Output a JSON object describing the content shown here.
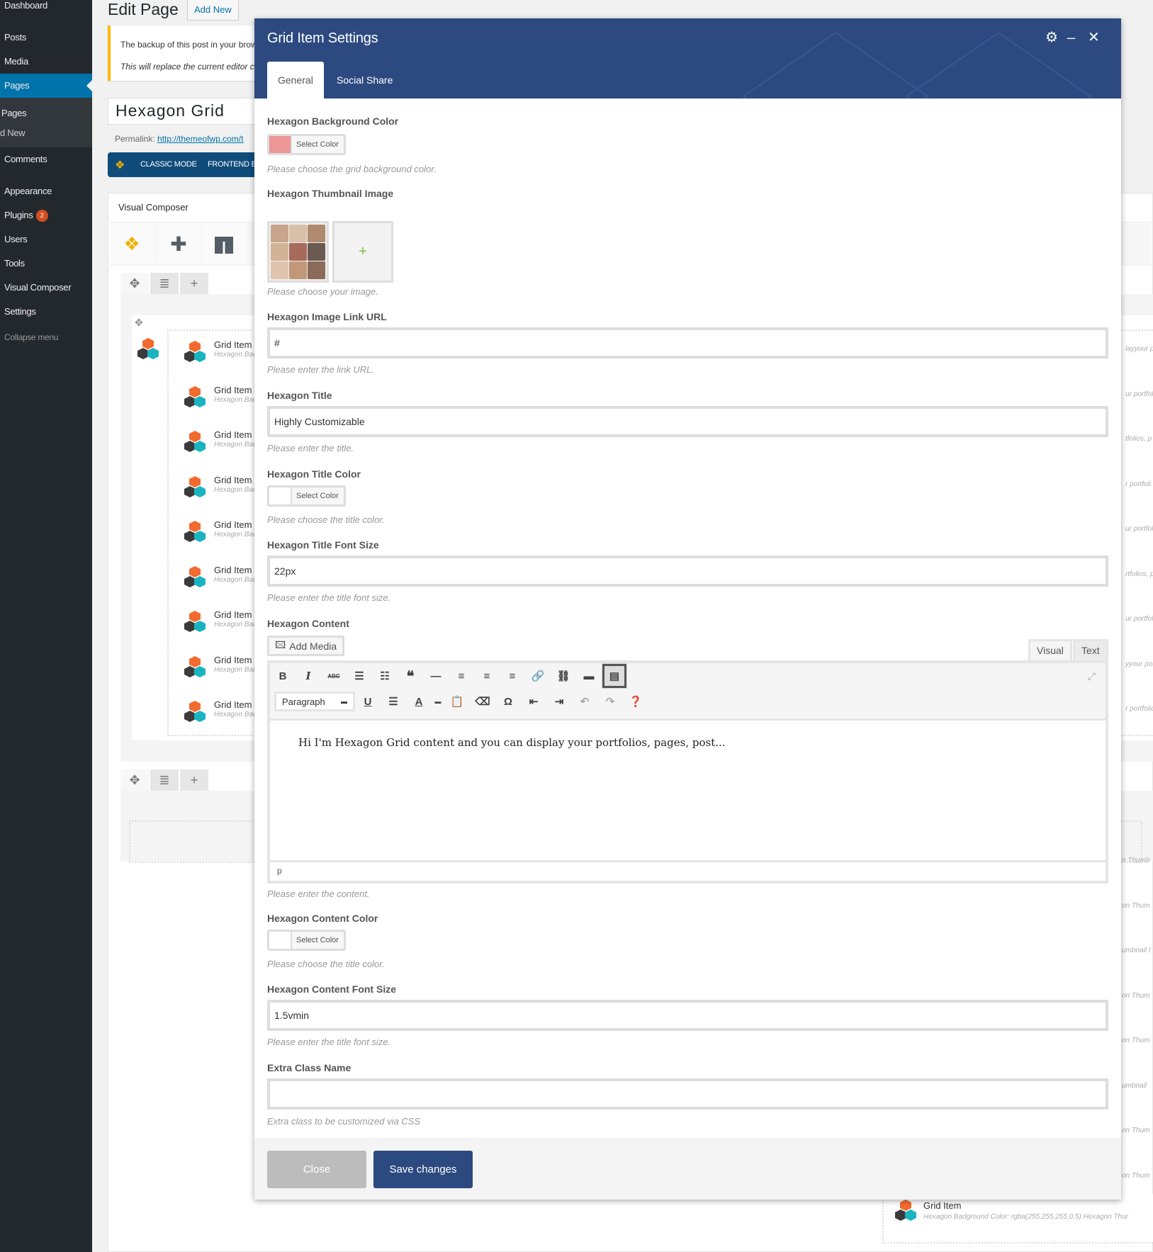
{
  "sidebar": {
    "items": [
      {
        "label": "Dashboard"
      },
      {
        "label": "Posts"
      },
      {
        "label": "Media"
      },
      {
        "label": "Pages"
      },
      {
        "label": "Comments"
      },
      {
        "label": "Appearance"
      },
      {
        "label": "Plugins",
        "badge": "2"
      },
      {
        "label": "Users"
      },
      {
        "label": "Tools"
      },
      {
        "label": "Visual Composer"
      },
      {
        "label": "Settings"
      }
    ],
    "submenu": [
      "Pages",
      "d New"
    ],
    "collapse": "Collapse menu"
  },
  "page": {
    "title": "Edit Page",
    "add_new": "Add New",
    "notice_line1": "The backup of this post in your brow",
    "notice_line2": "This will replace the current editor c",
    "post_title": "Hexagon Grid",
    "permalink_label": "Permalink:",
    "permalink_url": "http://themeofwp.com/t",
    "vc_classic": "CLASSIC MODE",
    "vc_frontend": "FRONTEND ED",
    "vc_panel_title": "Visual Composer"
  },
  "grid_items": {
    "title": "Grid Item",
    "subtitle": "Hexagon Badg",
    "right_snippets": [
      "layyour p",
      "ur portfol",
      "tfolios, p",
      "r portfoli",
      "ur portfol",
      "rtfolios, p",
      "ur portfol",
      "yyour por",
      "r portfolic"
    ],
    "lower_snippets": [
      "n Thumb",
      "on Thum",
      "umbnail I",
      "on Thum",
      "on Thum",
      "umbnail",
      "on Thum",
      "on Thum"
    ],
    "bottom_title": "Grid Item",
    "bottom_subtitle": "Hexagon Badground Color: rgba(255,255,255,0.5)  Hexagon Thur"
  },
  "modal": {
    "title": "Grid Item Settings",
    "tabs": [
      {
        "label": "General",
        "active": true
      },
      {
        "label": "Social Share",
        "active": false
      }
    ],
    "fields": {
      "bg_color": {
        "label": "Hexagon Background Color",
        "button": "Select Color",
        "swatch": "#ec9696",
        "help": "Please choose the grid background color."
      },
      "thumb": {
        "label": "Hexagon Thumbnail Image",
        "add": "+",
        "help": "Please choose your image."
      },
      "link": {
        "label": "Hexagon Image Link URL",
        "value": "#",
        "help": "Please enter the link URL."
      },
      "title": {
        "label": "Hexagon Title",
        "value": "Highly Customizable",
        "help": "Please enter the title."
      },
      "title_color": {
        "label": "Hexagon Title Color",
        "button": "Select Color",
        "swatch": "#ffffff",
        "help": "Please choose the title color."
      },
      "title_size": {
        "label": "Hexagon Title Font Size",
        "value": "22px",
        "help": "Please enter the title font size."
      },
      "content": {
        "label": "Hexagon Content",
        "add_media": "Add Media",
        "tab_visual": "Visual",
        "tab_text": "Text",
        "format": "Paragraph",
        "body": "Hi I'm Hexagon Grid content and you can display your portfolios, pages, post...",
        "status": "p",
        "help": "Please enter the content."
      },
      "content_color": {
        "label": "Hexagon Content Color",
        "button": "Select Color",
        "swatch": "#ffffff",
        "help": "Please choose the title color."
      },
      "content_size": {
        "label": "Hexagon Content Font Size",
        "value": "1.5vmin",
        "help": "Please enter the title font size."
      },
      "extra_class": {
        "label": "Extra Class Name",
        "value": "",
        "help": "Extra class to be customized via CSS"
      }
    },
    "close_label": "Close",
    "save_label": "Save changes"
  },
  "colors": {
    "accent": "#2c4a80",
    "wp_blue": "#0073aa",
    "sidebar": "#23282d",
    "close_btn": "#bcbcbc"
  }
}
